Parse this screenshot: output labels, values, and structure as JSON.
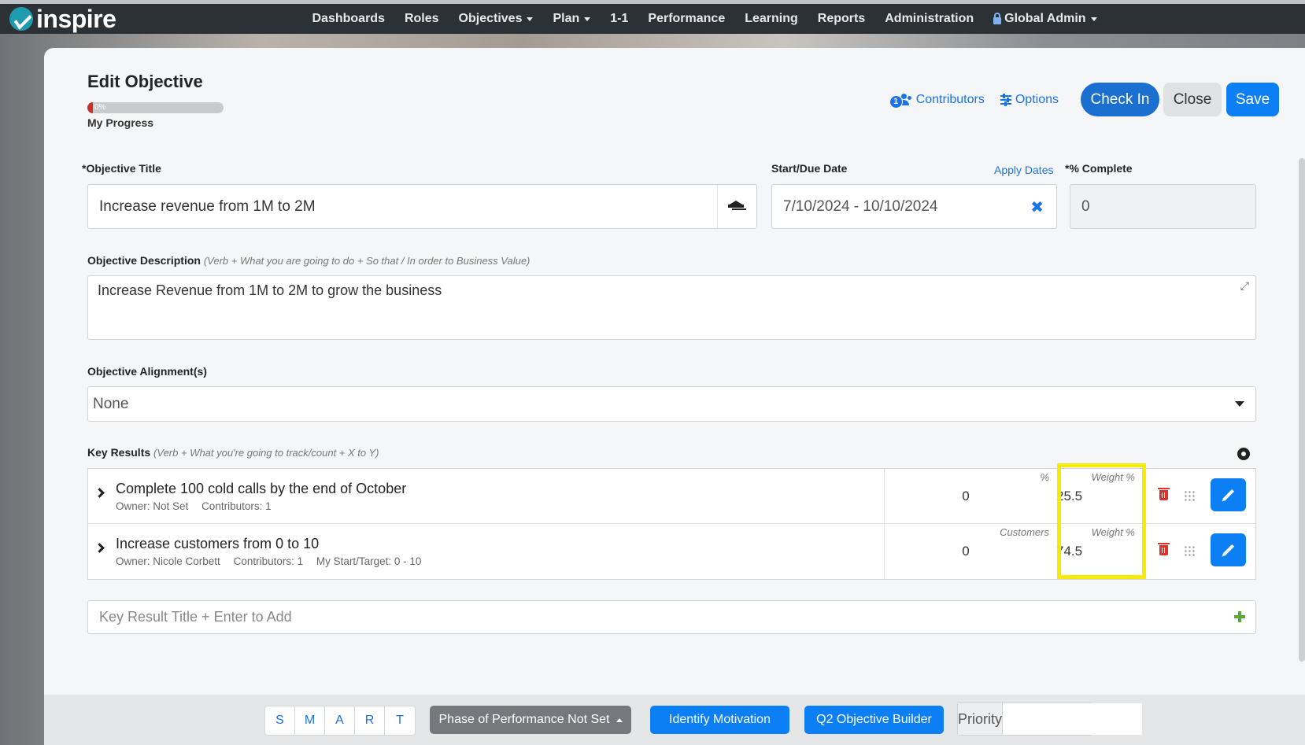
{
  "nav": {
    "logo": "inspire",
    "items": [
      "Dashboards",
      "Roles",
      "Objectives",
      "Plan",
      "1-1",
      "Performance",
      "Learning",
      "Reports",
      "Administration"
    ],
    "dropdown_items": [
      "Objectives",
      "Plan"
    ],
    "admin_label": "Global Admin"
  },
  "header": {
    "title": "Edit Objective",
    "progress_text": "0%",
    "progress_value": 0,
    "progress_label": "My Progress",
    "contributors_count": "1",
    "contributors_label": "Contributors",
    "options_label": "Options",
    "checkin_label": "Check In",
    "close_label": "Close",
    "save_label": "Save"
  },
  "form": {
    "title_label": "*Objective Title",
    "title_value": "Increase revenue from 1M to 2M",
    "date_label": "Start/Due Date",
    "apply_dates_label": "Apply Dates",
    "date_value": "7/10/2024 - 10/10/2024",
    "complete_label": "*% Complete",
    "complete_value": "0",
    "desc_label": "Objective Description",
    "desc_hint": "(Verb + What you are going to do + So that / In order to Business Value)",
    "desc_value": "Increase Revenue from 1M to 2M to grow the business",
    "alignment_label": "Objective Alignment(s)",
    "alignment_value": "None"
  },
  "key_results": {
    "label": "Key Results",
    "hint": "(Verb + What you're going to track/count + X to Y)",
    "rows": [
      {
        "title": "Complete 100 cold calls by the end of October",
        "owner": "Owner: Not Set",
        "contributors": "Contributors: 1",
        "extra": "",
        "unit": "%",
        "value": "0",
        "weight_label": "Weight %",
        "weight": "25.5"
      },
      {
        "title": "Increase customers from 0 to 10",
        "owner": "Owner: Nicole Corbett",
        "contributors": "Contributors: 1",
        "extra": "My Start/Target: 0 - 10",
        "unit": "Customers",
        "value": "0",
        "weight_label": "Weight %",
        "weight": "74.5"
      }
    ],
    "add_placeholder": "Key Result Title + Enter to Add"
  },
  "footer": {
    "smart": [
      "S",
      "M",
      "A",
      "R",
      "T"
    ],
    "phase_label": "Phase of Performance Not Set",
    "identify_label": "Identify Motivation",
    "builder_label": "Q2 Objective Builder",
    "priority_label": "Priority"
  },
  "colors": {
    "accent": "#0d7ff5",
    "nav_bg": "#2c3136",
    "highlight": "#f5ec00",
    "danger": "#d9342b",
    "success": "#5aa63a"
  }
}
